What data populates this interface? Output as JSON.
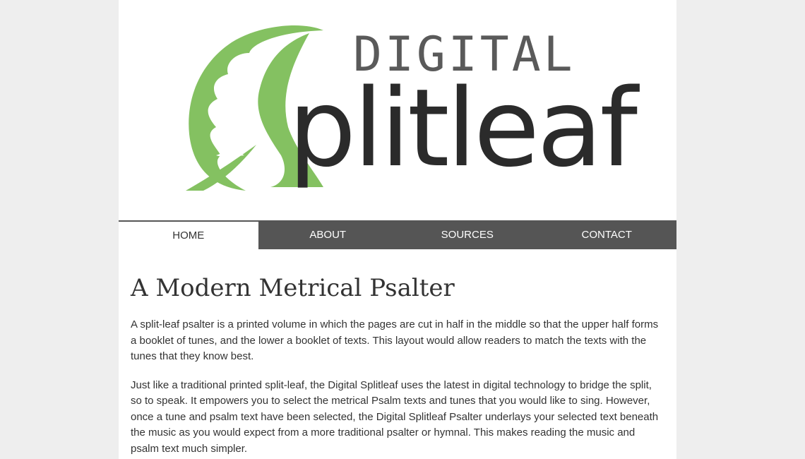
{
  "logo": {
    "top_word": "DIGITAL",
    "main_word": "plitleaf",
    "leaf_color": "#84c161"
  },
  "nav": {
    "items": [
      {
        "label": "HOME",
        "active": true
      },
      {
        "label": "ABOUT",
        "active": false
      },
      {
        "label": "SOURCES",
        "active": false
      },
      {
        "label": "CONTACT",
        "active": false
      }
    ]
  },
  "main": {
    "title": "A Modern Metrical Psalter",
    "paragraphs": [
      "A split-leaf psalter is a printed volume in which the pages are cut in half in the middle so that the upper half forms a booklet of tunes, and the lower a booklet of texts. This layout would allow readers to match the texts with the tunes that they know best.",
      "Just like a traditional printed split-leaf, the Digital Splitleaf uses the latest in digital technology to bridge the split, so to speak. It empowers you to select the metrical Psalm texts and tunes that you would like to sing. However, once a tune and psalm text have been selected, the Digital Splitleaf Psalter underlays your selected text beneath the music as you would expect from a more traditional psalter or hymnal. This makes reading the music and psalm text much simpler."
    ]
  }
}
